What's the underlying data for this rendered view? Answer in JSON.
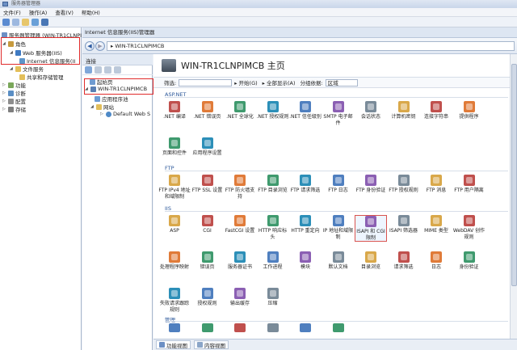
{
  "window": {
    "title": "服务器管理器"
  },
  "menu": [
    "文件(F)",
    "操作(A)",
    "查看(V)",
    "帮助(H)"
  ],
  "left_tree": {
    "root": "服务器管理器 (WIN-TR1CLNPI",
    "roles": "角色",
    "web_server": "Web 服务器(IIS)",
    "iis_manager": "Internet 信息服务(II",
    "file_services": "文件服务",
    "share_storage": "共享和存储管理",
    "features": "功能",
    "diagnostics": "诊断",
    "configuration": "配置",
    "storage": "存储"
  },
  "iis_title": "Internet 信息服务(IIS)管理器",
  "address": {
    "path": "WIN-TR1CLNPIMCB",
    "sep": "▸"
  },
  "connections": {
    "header": "连接",
    "start_page": "起始页",
    "server": "WIN-TR1CLNPIMCB",
    "app_pools": "应用程序池",
    "sites": "网站",
    "default_site": "Default Web S"
  },
  "home": {
    "title": "WIN-TR1CLNPIMCB 主页"
  },
  "filter": {
    "label": "筛选:",
    "start": "开始(G)",
    "show_all": "全部显示(A)",
    "group_by": "分组依据:",
    "group_value": "区域"
  },
  "sections": {
    "aspnet": "ASP.NET",
    "ftp": "FTP",
    "iis": "IIS",
    "manage": "管理"
  },
  "aspnet_items": [
    ".NET 编译",
    ".NET 错误页",
    ".NET 全球化",
    ".NET 授权规则",
    ".NET 信任级别",
    "SMTP 电子邮件",
    "会话状态",
    "计算机密钥",
    "连接字符串",
    "提供程序",
    "页面和控件",
    "应用程序设置"
  ],
  "ftp_items": [
    "FTP IPv4 地址和域限制",
    "FTP SSL 设置",
    "FTP 防火墙支持",
    "FTP 目录浏览",
    "FTP 请求筛选",
    "FTP 日志",
    "FTP 身份验证",
    "FTP 授权规则",
    "FTP 消息",
    "FTP 用户隔离"
  ],
  "iis_items": [
    "ASP",
    "CGI",
    "FastCGI 设置",
    "HTTP 响应标头",
    "HTTP 重定向",
    "IP 地址和域限制",
    "ISAPI 和 CGI 限制",
    "ISAPI 筛选器",
    "MIME 类型",
    "WebDAV 创作规则",
    "处理程序映射",
    "错误页",
    "服务器证书",
    "工作进程",
    "模块",
    "默认文档",
    "目录浏览",
    "请求筛选",
    "日志",
    "身份验证",
    "失败请求跟踪规则",
    "授权规则",
    "输出缓存",
    "压缩"
  ],
  "bottom_tabs": [
    "功能视图",
    "内容视图"
  ]
}
